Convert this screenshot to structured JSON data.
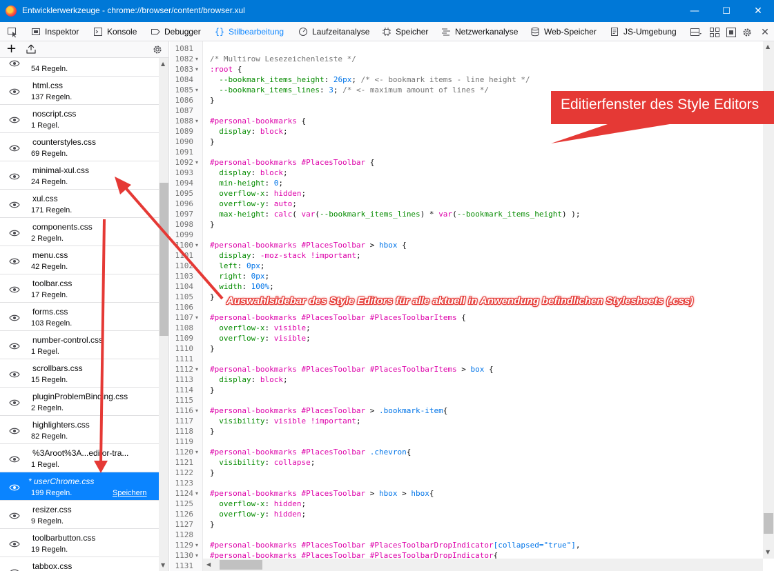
{
  "window": {
    "title": "Entwicklerwerkzeuge - chrome://browser/content/browser.xul",
    "minimize": "—",
    "maximize": "☐",
    "close": "✕"
  },
  "toolbar": {
    "tools": [
      {
        "label": "Inspektor",
        "icon": "inspector-icon"
      },
      {
        "label": "Konsole",
        "icon": "console-icon"
      },
      {
        "label": "Debugger",
        "icon": "debugger-icon"
      },
      {
        "label": "Stilbearbeitung",
        "icon": "style-editor-icon",
        "active": true
      },
      {
        "label": "Laufzeitanalyse",
        "icon": "performance-icon"
      },
      {
        "label": "Speicher",
        "icon": "memory-icon"
      },
      {
        "label": "Netzwerkanalyse",
        "icon": "network-icon"
      },
      {
        "label": "Web-Speicher",
        "icon": "storage-icon"
      },
      {
        "label": "JS-Umgebung",
        "icon": "scratchpad-icon"
      }
    ],
    "close": "✕"
  },
  "sidebar": {
    "new_symbol": "+",
    "import_symbol": "⇧",
    "items": [
      {
        "name": "",
        "rules": "54 Regeln."
      },
      {
        "name": "html.css",
        "rules": "137 Regeln."
      },
      {
        "name": "noscript.css",
        "rules": "1 Regel."
      },
      {
        "name": "counterstyles.css",
        "rules": "69 Regeln."
      },
      {
        "name": "minimal-xul.css",
        "rules": "24 Regeln."
      },
      {
        "name": "xul.css",
        "rules": "171 Regeln."
      },
      {
        "name": "components.css",
        "rules": "2 Regeln."
      },
      {
        "name": "menu.css",
        "rules": "42 Regeln."
      },
      {
        "name": "toolbar.css",
        "rules": "17 Regeln."
      },
      {
        "name": "forms.css",
        "rules": "103 Regeln."
      },
      {
        "name": "number-control.css",
        "rules": "1 Regel."
      },
      {
        "name": "scrollbars.css",
        "rules": "15 Regeln."
      },
      {
        "name": "pluginProblemBinding.css",
        "rules": "2 Regeln."
      },
      {
        "name": "highlighters.css",
        "rules": "82 Regeln."
      },
      {
        "name": "%3Aroot%3A...editor-tra...",
        "rules": "1 Regel."
      },
      {
        "name": "* userChrome.css",
        "rules": "199 Regeln.",
        "selected": true,
        "save_label": "Speichern"
      },
      {
        "name": "resizer.css",
        "rules": "9 Regeln."
      },
      {
        "name": "toolbarbutton.css",
        "rules": "19 Regeln."
      },
      {
        "name": "tabbox.css",
        "rules": ""
      }
    ]
  },
  "editor": {
    "lines": [
      {
        "n": "1081",
        "f": false,
        "code": [
          [
            "",
            ""
          ]
        ]
      },
      {
        "n": "1082",
        "f": true,
        "code": [
          [
            "c",
            "/* Multirow Lesezeichenleiste */"
          ]
        ]
      },
      {
        "n": "1083",
        "f": true,
        "code": [
          [
            "s",
            ":root"
          ],
          [
            "",
            " {"
          ]
        ]
      },
      {
        "n": "1084",
        "f": false,
        "code": [
          [
            "",
            "  "
          ],
          [
            "p",
            "--bookmark_items_height"
          ],
          [
            "",
            ": "
          ],
          [
            "n",
            "26px"
          ],
          [
            "",
            "; "
          ],
          [
            "c",
            "/* <- bookmark items - line height */"
          ]
        ]
      },
      {
        "n": "1085",
        "f": true,
        "code": [
          [
            "",
            "  "
          ],
          [
            "p",
            "--bookmark_items_lines"
          ],
          [
            "",
            ": "
          ],
          [
            "n",
            "3"
          ],
          [
            "",
            "; "
          ],
          [
            "c",
            "/* <- maximum amount of lines */"
          ]
        ]
      },
      {
        "n": "1086",
        "f": false,
        "code": [
          [
            "",
            "}"
          ]
        ]
      },
      {
        "n": "1087",
        "f": false,
        "code": [
          [
            "",
            ""
          ]
        ]
      },
      {
        "n": "1088",
        "f": true,
        "code": [
          [
            "s",
            "#personal-bookmarks"
          ],
          [
            "",
            " {"
          ]
        ]
      },
      {
        "n": "1089",
        "f": false,
        "code": [
          [
            "",
            "  "
          ],
          [
            "p",
            "display"
          ],
          [
            "",
            ": "
          ],
          [
            "v",
            "block"
          ],
          [
            "",
            ";"
          ]
        ]
      },
      {
        "n": "1090",
        "f": false,
        "code": [
          [
            "",
            "}"
          ]
        ]
      },
      {
        "n": "1091",
        "f": false,
        "code": [
          [
            "",
            ""
          ]
        ]
      },
      {
        "n": "1092",
        "f": true,
        "code": [
          [
            "s",
            "#personal-bookmarks #PlacesToolbar"
          ],
          [
            "",
            " {"
          ]
        ]
      },
      {
        "n": "1093",
        "f": false,
        "code": [
          [
            "",
            "  "
          ],
          [
            "p",
            "display"
          ],
          [
            "",
            ": "
          ],
          [
            "v",
            "block"
          ],
          [
            "",
            ";"
          ]
        ]
      },
      {
        "n": "1094",
        "f": false,
        "code": [
          [
            "",
            "  "
          ],
          [
            "p",
            "min-height"
          ],
          [
            "",
            ": "
          ],
          [
            "n",
            "0"
          ],
          [
            "",
            ";"
          ]
        ]
      },
      {
        "n": "1095",
        "f": false,
        "code": [
          [
            "",
            "  "
          ],
          [
            "p",
            "overflow-x"
          ],
          [
            "",
            ": "
          ],
          [
            "v",
            "hidden"
          ],
          [
            "",
            ";"
          ]
        ]
      },
      {
        "n": "1096",
        "f": false,
        "code": [
          [
            "",
            "  "
          ],
          [
            "p",
            "overflow-y"
          ],
          [
            "",
            ": "
          ],
          [
            "v",
            "auto"
          ],
          [
            "",
            ";"
          ]
        ]
      },
      {
        "n": "1097",
        "f": false,
        "code": [
          [
            "",
            "  "
          ],
          [
            "p",
            "max-height"
          ],
          [
            "",
            ": "
          ],
          [
            "v",
            "calc"
          ],
          [
            "",
            "( "
          ],
          [
            "v",
            "var"
          ],
          [
            "",
            "("
          ],
          [
            "p",
            "--bookmark_items_lines"
          ],
          [
            "",
            ") * "
          ],
          [
            "v",
            "var"
          ],
          [
            "",
            "("
          ],
          [
            "p",
            "--bookmark_items_height"
          ],
          [
            "",
            ") );"
          ]
        ]
      },
      {
        "n": "1098",
        "f": false,
        "code": [
          [
            "",
            "}"
          ]
        ]
      },
      {
        "n": "1099",
        "f": false,
        "code": [
          [
            "",
            ""
          ]
        ]
      },
      {
        "n": "1100",
        "f": true,
        "code": [
          [
            "s",
            "#personal-bookmarks #PlacesToolbar"
          ],
          [
            "",
            " > "
          ],
          [
            "k",
            "hbox"
          ],
          [
            "",
            " {"
          ]
        ]
      },
      {
        "n": "1101",
        "f": false,
        "code": [
          [
            "",
            "  "
          ],
          [
            "p",
            "display"
          ],
          [
            "",
            ": "
          ],
          [
            "v",
            "-moz-stack"
          ],
          [
            "",
            " "
          ],
          [
            "v",
            "!important"
          ],
          [
            "",
            ";"
          ]
        ]
      },
      {
        "n": "1102",
        "f": false,
        "code": [
          [
            "",
            "  "
          ],
          [
            "p",
            "left"
          ],
          [
            "",
            ": "
          ],
          [
            "n",
            "0px"
          ],
          [
            "",
            ";"
          ]
        ]
      },
      {
        "n": "1103",
        "f": false,
        "code": [
          [
            "",
            "  "
          ],
          [
            "p",
            "right"
          ],
          [
            "",
            ": "
          ],
          [
            "n",
            "0px"
          ],
          [
            "",
            ";"
          ]
        ]
      },
      {
        "n": "1104",
        "f": false,
        "code": [
          [
            "",
            "  "
          ],
          [
            "p",
            "width"
          ],
          [
            "",
            ": "
          ],
          [
            "n",
            "100%"
          ],
          [
            "",
            ";"
          ]
        ]
      },
      {
        "n": "1105",
        "f": false,
        "code": [
          [
            "",
            "}"
          ]
        ]
      },
      {
        "n": "1106",
        "f": false,
        "code": [
          [
            "",
            ""
          ]
        ]
      },
      {
        "n": "1107",
        "f": true,
        "code": [
          [
            "s",
            "#personal-bookmarks #PlacesToolbar #PlacesToolbarItems"
          ],
          [
            "",
            " {"
          ]
        ]
      },
      {
        "n": "1108",
        "f": false,
        "code": [
          [
            "",
            "  "
          ],
          [
            "p",
            "overflow-x"
          ],
          [
            "",
            ": "
          ],
          [
            "v",
            "visible"
          ],
          [
            "",
            ";"
          ]
        ]
      },
      {
        "n": "1109",
        "f": false,
        "code": [
          [
            "",
            "  "
          ],
          [
            "p",
            "overflow-y"
          ],
          [
            "",
            ": "
          ],
          [
            "v",
            "visible"
          ],
          [
            "",
            ";"
          ]
        ]
      },
      {
        "n": "1110",
        "f": false,
        "code": [
          [
            "",
            "}"
          ]
        ]
      },
      {
        "n": "1111",
        "f": false,
        "code": [
          [
            "",
            ""
          ]
        ]
      },
      {
        "n": "1112",
        "f": true,
        "code": [
          [
            "s",
            "#personal-bookmarks #PlacesToolbar #PlacesToolbarItems"
          ],
          [
            "",
            " > "
          ],
          [
            "k",
            "box"
          ],
          [
            "",
            " {"
          ]
        ]
      },
      {
        "n": "1113",
        "f": false,
        "code": [
          [
            "",
            "  "
          ],
          [
            "p",
            "display"
          ],
          [
            "",
            ": "
          ],
          [
            "v",
            "block"
          ],
          [
            "",
            ";"
          ]
        ]
      },
      {
        "n": "1114",
        "f": false,
        "code": [
          [
            "",
            "}"
          ]
        ]
      },
      {
        "n": "1115",
        "f": false,
        "code": [
          [
            "",
            ""
          ]
        ]
      },
      {
        "n": "1116",
        "f": true,
        "code": [
          [
            "s",
            "#personal-bookmarks #PlacesToolbar"
          ],
          [
            "",
            " > "
          ],
          [
            "k",
            ".bookmark-item"
          ],
          [
            "",
            "{"
          ]
        ]
      },
      {
        "n": "1117",
        "f": false,
        "code": [
          [
            "",
            "  "
          ],
          [
            "p",
            "visibility"
          ],
          [
            "",
            ": "
          ],
          [
            "v",
            "visible"
          ],
          [
            "",
            " "
          ],
          [
            "v",
            "!important"
          ],
          [
            "",
            ";"
          ]
        ]
      },
      {
        "n": "1118",
        "f": false,
        "code": [
          [
            "",
            "}"
          ]
        ]
      },
      {
        "n": "1119",
        "f": false,
        "code": [
          [
            "",
            ""
          ]
        ]
      },
      {
        "n": "1120",
        "f": true,
        "code": [
          [
            "s",
            "#personal-bookmarks #PlacesToolbar"
          ],
          [
            "",
            " "
          ],
          [
            "k",
            ".chevron"
          ],
          [
            "",
            "{"
          ]
        ]
      },
      {
        "n": "1121",
        "f": false,
        "code": [
          [
            "",
            "  "
          ],
          [
            "p",
            "visibility"
          ],
          [
            "",
            ": "
          ],
          [
            "v",
            "collapse"
          ],
          [
            "",
            ";"
          ]
        ]
      },
      {
        "n": "1122",
        "f": false,
        "code": [
          [
            "",
            "}"
          ]
        ]
      },
      {
        "n": "1123",
        "f": false,
        "code": [
          [
            "",
            ""
          ]
        ]
      },
      {
        "n": "1124",
        "f": true,
        "code": [
          [
            "s",
            "#personal-bookmarks #PlacesToolbar"
          ],
          [
            "",
            " > "
          ],
          [
            "k",
            "hbox"
          ],
          [
            "",
            " > "
          ],
          [
            "k",
            "hbox"
          ],
          [
            "",
            "{"
          ]
        ]
      },
      {
        "n": "1125",
        "f": false,
        "code": [
          [
            "",
            "  "
          ],
          [
            "p",
            "overflow-x"
          ],
          [
            "",
            ": "
          ],
          [
            "v",
            "hidden"
          ],
          [
            "",
            ";"
          ]
        ]
      },
      {
        "n": "1126",
        "f": false,
        "code": [
          [
            "",
            "  "
          ],
          [
            "p",
            "overflow-y"
          ],
          [
            "",
            ": "
          ],
          [
            "v",
            "hidden"
          ],
          [
            "",
            ";"
          ]
        ]
      },
      {
        "n": "1127",
        "f": false,
        "code": [
          [
            "",
            "}"
          ]
        ]
      },
      {
        "n": "1128",
        "f": false,
        "code": [
          [
            "",
            ""
          ]
        ]
      },
      {
        "n": "1129",
        "f": true,
        "code": [
          [
            "s",
            "#personal-bookmarks #PlacesToolbar #PlacesToolbarDropIndicator"
          ],
          [
            "k",
            "[collapsed="
          ],
          [
            "n",
            "\"true\""
          ],
          [
            "k",
            "]"
          ],
          [
            "",
            ","
          ]
        ]
      },
      {
        "n": "1130",
        "f": true,
        "code": [
          [
            "s",
            "#personal-bookmarks #PlacesToolbar #PlacesToolbarDropIndicator"
          ],
          [
            "",
            "{"
          ]
        ]
      },
      {
        "n": "1131",
        "f": false,
        "code": [
          [
            "",
            ""
          ]
        ]
      }
    ]
  },
  "annotations": {
    "callout": "Editierfenster des Style Editors",
    "sidebar_note": "Auswahlsidebar des Style Editors für alle aktuell in Anwendung befindlichen Stylesheets (.css)",
    "color": "#e53935"
  },
  "colors": {
    "titlebar": "#0078d7",
    "accent": "#0a84ff",
    "annotation": "#e53935"
  }
}
